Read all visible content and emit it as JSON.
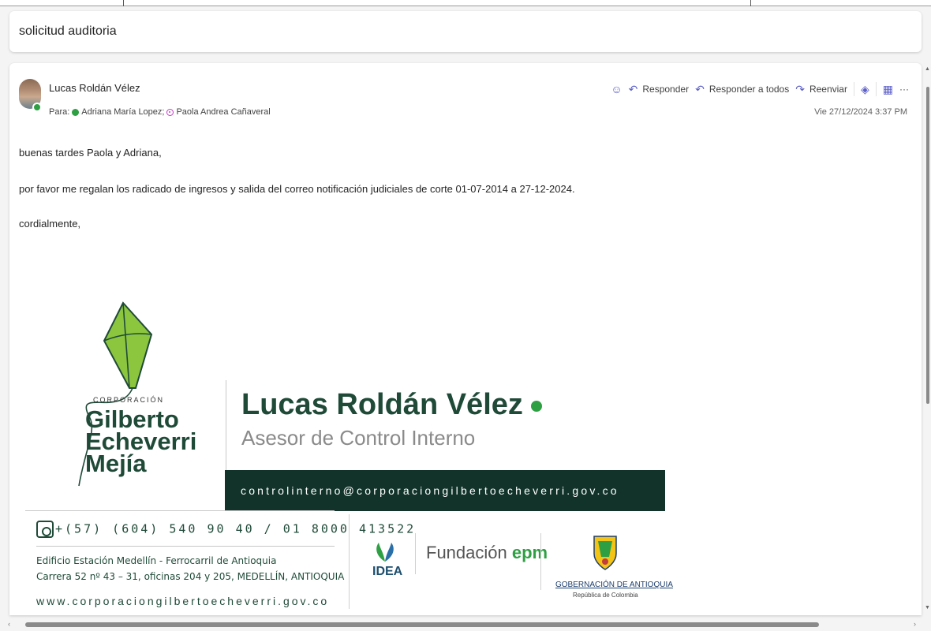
{
  "subject": "solicitud auditoria",
  "message": {
    "sender": "Lucas Roldán Vélez",
    "to_label": "Para:",
    "recipients": [
      "Adriana María Lopez;",
      "Paola Andrea Cañaveral"
    ],
    "date": "Vie 27/12/2024 3:37 PM",
    "actions": {
      "emoji_icon": "smiley-icon",
      "reply": "Responder",
      "reply_all": "Responder a todos",
      "forward": "Reenviar",
      "more": "···"
    },
    "body": [
      "buenas tardes Paola y Adriana,",
      "por favor me regalan los radicado de ingresos y salida del correo notificación judiciales de corte 01-07-2014 a 27-12-2024.",
      "cordialmente,"
    ]
  },
  "signature": {
    "corp_small": "CORPORACIÓN",
    "corp_name_1": "Gilberto",
    "corp_name_2": "Echeverri",
    "corp_name_3": "Mejía",
    "name": "Lucas Roldán Vélez",
    "role": "Asesor de Control Interno",
    "email": "controlinterno@corporaciongilbertoecheverri.gov.co",
    "phone": "+(57) (604) 540 90 40 / 01 8000 413522",
    "address_1": "Edificio Estación Medellín - Ferrocarril de Antioquia",
    "address_2": "Carrera 52 nº 43 – 31, oficinas 204 y 205, MEDELLÍN, ANTIOQUIA",
    "web": "www.corporaciongilbertoecheverri.gov.co",
    "logo_idea": "IDEA",
    "logo_epm_text": "Fundación",
    "logo_epm_brand": "epm",
    "logo_gob": "GOBERNACIÓN DE ANTIOQUIA",
    "logo_gob_sub": "República de Colombia"
  },
  "colors": {
    "accent": "#5b5fc7",
    "presence": "#2ea043",
    "brand_dark": "#12332a",
    "brand_green": "#1f4a38"
  }
}
